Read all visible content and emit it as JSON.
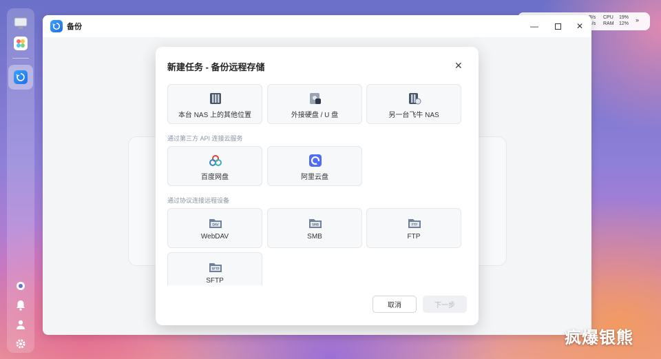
{
  "window": {
    "title": "备份"
  },
  "status": {
    "net_up": "B/s",
    "net_down": "B/s",
    "cpu_label": "CPU",
    "cpu_value": "19%",
    "ram_label": "RAM",
    "ram_value": "12%"
  },
  "modal": {
    "title": "新建任务 - 备份远程存储",
    "close_icon": "close-icon",
    "local_options": [
      {
        "label": "本台 NAS 上的其他位置",
        "icon": "nas-icon"
      },
      {
        "label": "外接硬盘 / U 盘",
        "icon": "external-drive-icon"
      },
      {
        "label": "另一台飞牛 NAS",
        "icon": "remote-nas-icon"
      }
    ],
    "cloud_section_label": "通过第三方 API 连接云服务",
    "cloud_options": [
      {
        "label": "百度网盘",
        "icon": "baidu-netdisk-icon"
      },
      {
        "label": "阿里云盘",
        "icon": "aliyun-drive-icon"
      }
    ],
    "protocol_section_label": "通过协议连接远程设备",
    "protocol_options": [
      {
        "label": "WebDAV",
        "tag": "DAV",
        "icon": "webdav-icon"
      },
      {
        "label": "SMB",
        "tag": "SMB",
        "icon": "smb-icon"
      },
      {
        "label": "FTP",
        "tag": "FTP",
        "icon": "ftp-icon"
      },
      {
        "label": "SFTP",
        "tag": "SFTP",
        "icon": "sftp-icon"
      }
    ],
    "cancel_label": "取消",
    "next_label": "下一步"
  },
  "watermark": "疯爆银熊",
  "colors": {
    "accent": "#1e6fe8",
    "section_text": "#8a94a6"
  }
}
